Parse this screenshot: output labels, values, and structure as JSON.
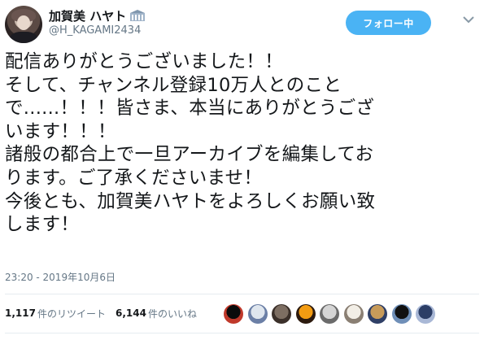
{
  "user": {
    "display_name": "加賀美 ハヤト",
    "badge_icon": "building-icon",
    "handle": "@H_KAGAMI2434",
    "avatar_icon": "profile-avatar"
  },
  "follow_button": {
    "label": "フォロー中"
  },
  "menu": {
    "icon": "chevron-down-icon"
  },
  "tweet": {
    "lines": [
      "配信ありがとうございました！！",
      "そして、チャンネル登録10万人とのこと",
      "で......！！！皆さま、本当にありがとうござ",
      "います！！！",
      "諸般の都合上で一旦アーカイブを編集してお",
      "ります。ご了承くださいませ！",
      "今後とも、加賀美ハヤトをよろしくお願い致",
      "します！"
    ]
  },
  "timestamp": "23:20 - 2019年10月6日",
  "stats": {
    "retweets_count": "1,117",
    "retweets_label": "件のリツイート",
    "likes_count": "6,144",
    "likes_label": "件のいいね"
  },
  "likers": [
    {
      "name": "liker-avatar-1",
      "colors": [
        "#0b0b0b",
        "#c0392b"
      ]
    },
    {
      "name": "liker-avatar-2",
      "colors": [
        "#dfe6ee",
        "#6b7fa6"
      ]
    },
    {
      "name": "liker-avatar-3",
      "colors": [
        "#7d6e62",
        "#3b302a"
      ]
    },
    {
      "name": "liker-avatar-4",
      "colors": [
        "#f39c12",
        "#2c1a0e"
      ]
    },
    {
      "name": "liker-avatar-5",
      "colors": [
        "#d5d5d5",
        "#6b6b6b"
      ]
    },
    {
      "name": "liker-avatar-6",
      "colors": [
        "#f2eee6",
        "#8a7f73"
      ]
    },
    {
      "name": "liker-avatar-7",
      "colors": [
        "#c79b5a",
        "#2f3f66"
      ]
    },
    {
      "name": "liker-avatar-8",
      "colors": [
        "#111111",
        "#6f8fb8"
      ]
    },
    {
      "name": "liker-avatar-9",
      "colors": [
        "#2c3e66",
        "#a9b8d6"
      ]
    }
  ],
  "colors": {
    "accent": "#4ab3f4",
    "secondary_text": "#657786",
    "primary_text": "#14171a"
  }
}
